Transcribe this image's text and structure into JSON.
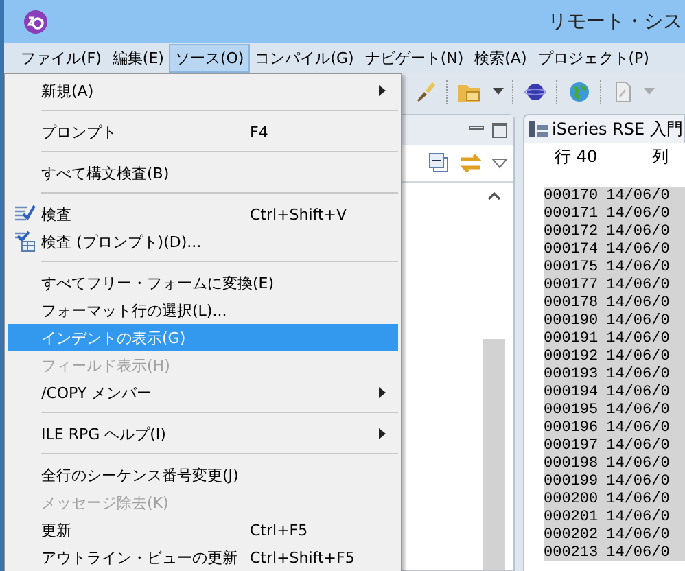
{
  "window": {
    "title": "リモート・シス"
  },
  "menubar": [
    {
      "label": "ファイル(F)",
      "selected": false
    },
    {
      "label": "編集(E)",
      "selected": false
    },
    {
      "label": "ソース(O)",
      "selected": true
    },
    {
      "label": "コンパイル(G)",
      "selected": false
    },
    {
      "label": "ナビゲート(N)",
      "selected": false
    },
    {
      "label": "検索(A)",
      "selected": false
    },
    {
      "label": "プロジェクト(P)",
      "selected": false
    }
  ],
  "source_menu": [
    {
      "kind": "command",
      "label": "新規(A)",
      "submenu": true,
      "disabled": false,
      "selected": false
    },
    {
      "kind": "separator"
    },
    {
      "kind": "command",
      "label": "プロンプト",
      "shortcut": "F4",
      "submenu": false,
      "disabled": false,
      "selected": false
    },
    {
      "kind": "separator"
    },
    {
      "kind": "command",
      "label": "すべて構文検査(B)",
      "submenu": false,
      "disabled": false,
      "selected": false
    },
    {
      "kind": "separator"
    },
    {
      "kind": "verify",
      "label": "検査",
      "shortcut": "Ctrl+Shift+V",
      "submenu": false,
      "disabled": false,
      "selected": false
    },
    {
      "kind": "verifyprompt",
      "label": "検査 (プロンプト)(D)...",
      "submenu": false,
      "disabled": false,
      "selected": false
    },
    {
      "kind": "separator"
    },
    {
      "kind": "command",
      "label": "すべてフリー・フォームに変換(E)",
      "submenu": false,
      "disabled": false,
      "selected": false
    },
    {
      "kind": "command",
      "label": "フォーマット行の選択(L)...",
      "submenu": false,
      "disabled": false,
      "selected": false
    },
    {
      "kind": "command",
      "label": "インデントの表示(G)",
      "submenu": false,
      "disabled": false,
      "selected": true
    },
    {
      "kind": "command",
      "label": "フィールド表示(H)",
      "submenu": false,
      "disabled": true,
      "selected": false
    },
    {
      "kind": "command",
      "label": "/COPY メンバー",
      "submenu": true,
      "disabled": false,
      "selected": false
    },
    {
      "kind": "separator"
    },
    {
      "kind": "command",
      "label": "ILE RPG ヘルプ(I)",
      "submenu": true,
      "disabled": false,
      "selected": false
    },
    {
      "kind": "separator"
    },
    {
      "kind": "command",
      "label": "全行のシーケンス番号変更(J)",
      "submenu": false,
      "disabled": false,
      "selected": false
    },
    {
      "kind": "command",
      "label": "メッセージ除去(K)",
      "submenu": false,
      "disabled": true,
      "selected": false
    },
    {
      "kind": "command",
      "label": "更新",
      "shortcut": "Ctrl+F5",
      "submenu": false,
      "disabled": false,
      "selected": false
    },
    {
      "kind": "command",
      "label": "アウトライン・ビューの更新",
      "shortcut": "Ctrl+Shift+F5",
      "submenu": false,
      "disabled": false,
      "selected": false
    }
  ],
  "editor": {
    "tab": "iSeries RSE 入門",
    "line": "行 40",
    "column": "列",
    "rows": [
      {
        "seq": "000170",
        "date": "14/06/0"
      },
      {
        "seq": "000171",
        "date": "14/06/0"
      },
      {
        "seq": "000172",
        "date": "14/06/0"
      },
      {
        "seq": "000174",
        "date": "14/06/0"
      },
      {
        "seq": "000175",
        "date": "14/06/0"
      },
      {
        "seq": "000177",
        "date": "14/06/0"
      },
      {
        "seq": "000178",
        "date": "14/06/0"
      },
      {
        "seq": "000190",
        "date": "14/06/0"
      },
      {
        "seq": "000191",
        "date": "14/06/0"
      },
      {
        "seq": "000192",
        "date": "14/06/0"
      },
      {
        "seq": "000193",
        "date": "14/06/0"
      },
      {
        "seq": "000194",
        "date": "14/06/0"
      },
      {
        "seq": "000195",
        "date": "14/06/0"
      },
      {
        "seq": "000196",
        "date": "14/06/0"
      },
      {
        "seq": "000197",
        "date": "14/06/0"
      },
      {
        "seq": "000198",
        "date": "14/06/0"
      },
      {
        "seq": "000199",
        "date": "14/06/0"
      },
      {
        "seq": "000200",
        "date": "14/06/0"
      },
      {
        "seq": "000201",
        "date": "14/06/0"
      },
      {
        "seq": "000202",
        "date": "14/06/0"
      },
      {
        "seq": "000213",
        "date": "14/06/0"
      }
    ]
  }
}
